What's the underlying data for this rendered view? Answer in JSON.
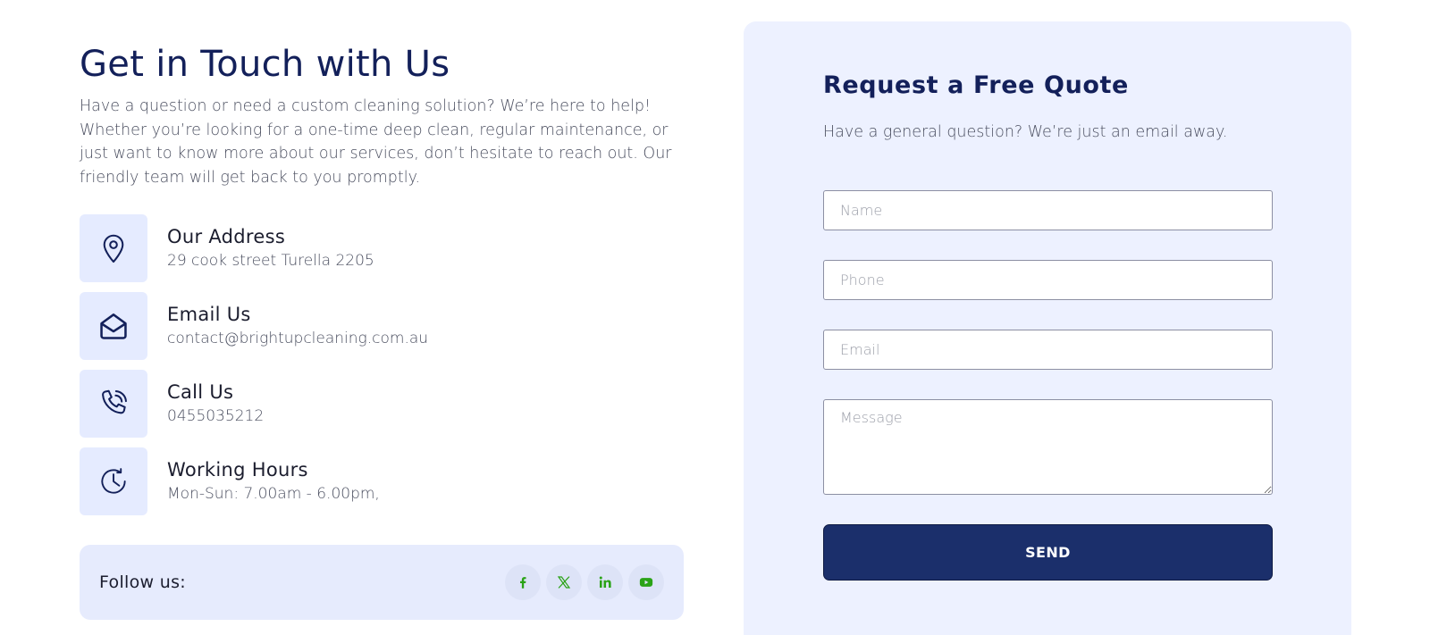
{
  "contact": {
    "title": "Get in Touch with Us",
    "intro": "Have a question or need a custom cleaning solution? We’re here to help! Whether you’re looking for a one-time deep clean, regular maintenance, or just want to know more about our services, don’t hesitate to reach out. Our friendly team will get back to you promptly.",
    "items": [
      {
        "icon": "location-pin-icon",
        "title": "Our Address",
        "value": "29 cook street Turella 2205"
      },
      {
        "icon": "envelope-icon",
        "title": "Email Us",
        "value": "contact@brightupcleaning.com.au"
      },
      {
        "icon": "phone-icon",
        "title": "Call Us",
        "value": "0455035212"
      },
      {
        "icon": "clock-icon",
        "title": "Working Hours",
        "value": "Mon-Sun: 7.00am - 6.00pm,"
      }
    ]
  },
  "follow": {
    "label": "Follow us:",
    "icon_color": "#2aa316",
    "socials": [
      "facebook-icon",
      "x-icon",
      "linkedin-icon",
      "youtube-icon"
    ]
  },
  "quote": {
    "title": "Request a Free Quote",
    "subtitle": "Have a general question? We’re just an email away.",
    "fields": {
      "name_placeholder": "Name",
      "phone_placeholder": "Phone",
      "email_placeholder": "Email",
      "message_placeholder": "Message"
    },
    "send_label": "SEND"
  },
  "colors": {
    "heading": "#13205a",
    "icon_bg": "#e5ebff",
    "card_bg": "#edf1ff",
    "button_bg": "#1b2f6b"
  }
}
